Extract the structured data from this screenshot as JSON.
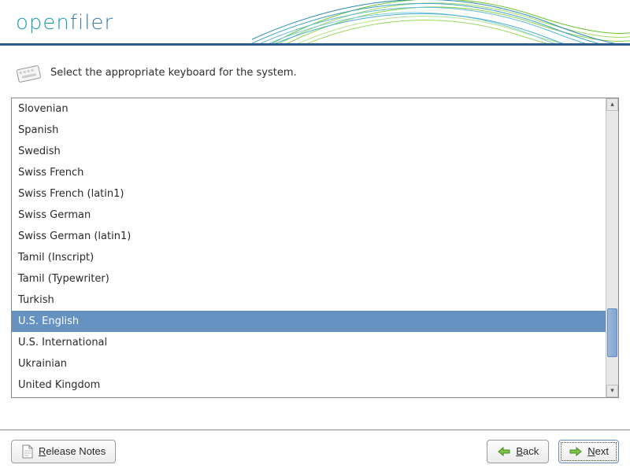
{
  "brand": {
    "open": "open",
    "filer": "filer"
  },
  "instruction": "Select the appropriate keyboard for the system.",
  "keyboard_list": {
    "items": [
      "Slovenian",
      "Spanish",
      "Swedish",
      "Swiss French",
      "Swiss French (latin1)",
      "Swiss German",
      "Swiss German (latin1)",
      "Tamil (Inscript)",
      "Tamil (Typewriter)",
      "Turkish",
      "U.S. English",
      "U.S. International",
      "Ukrainian",
      "United Kingdom"
    ],
    "selected_index": 10
  },
  "buttons": {
    "release_notes": {
      "prefix": "R",
      "rest": "elease Notes"
    },
    "back": {
      "prefix": "B",
      "rest": "ack"
    },
    "next": {
      "prefix": "N",
      "rest": "ext"
    }
  },
  "colors": {
    "accent_blue": "#6692c1",
    "header_rule": "#2c5a8c",
    "logo_teal": "#1a9cb0",
    "logo_blue": "#3a7ba8"
  }
}
